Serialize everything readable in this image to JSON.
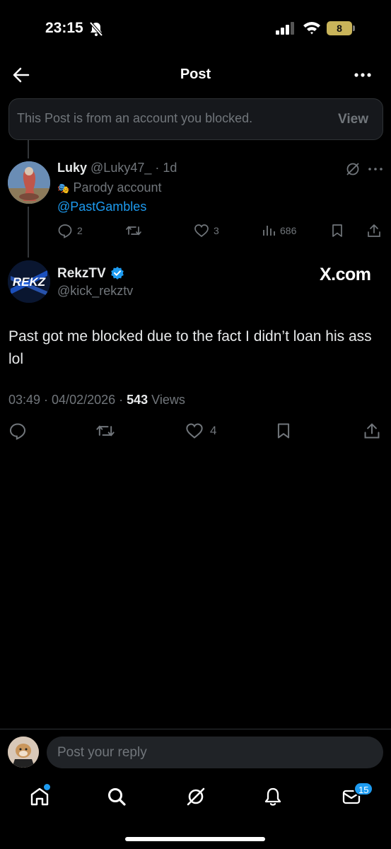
{
  "status_bar": {
    "time": "23:15",
    "battery_level": "8",
    "icons": [
      "bell-slash-icon",
      "signal-icon",
      "wifi-icon",
      "battery-icon"
    ]
  },
  "header": {
    "title": "Post",
    "back_icon": "arrow-left-icon",
    "more_icon": "more-horizontal-icon"
  },
  "blocked_notice": {
    "text": "This Post is from an account you blocked.",
    "action": "View"
  },
  "reply_post": {
    "name": "Luky",
    "handle_time": "@Luky47_ · 1d",
    "label_icon": "🎭",
    "label": "Parody account",
    "text": "@PastGambles",
    "replies": "2",
    "likes": "3",
    "views": "686"
  },
  "main_post": {
    "name": "RekzTV",
    "handle": "@kick_rekztv",
    "watermark": "X.com",
    "text": "Past got me blocked due to the fact I didn’t loan his ass lol",
    "time_date": "03:49 · 04/02/2026 · ",
    "views_count": "543",
    "views_label": " Views",
    "likes": "4"
  },
  "composer": {
    "placeholder": "Post your reply"
  },
  "bottom_nav": {
    "items": [
      "home-icon",
      "search-icon",
      "grok-icon",
      "notifications-icon",
      "messages-icon"
    ],
    "messages_badge": "15"
  },
  "colors": {
    "background": "#000000",
    "text": "#e7e9ea",
    "muted": "#71767b",
    "accent": "#1d9bf0",
    "battery": "#c9b45a"
  }
}
